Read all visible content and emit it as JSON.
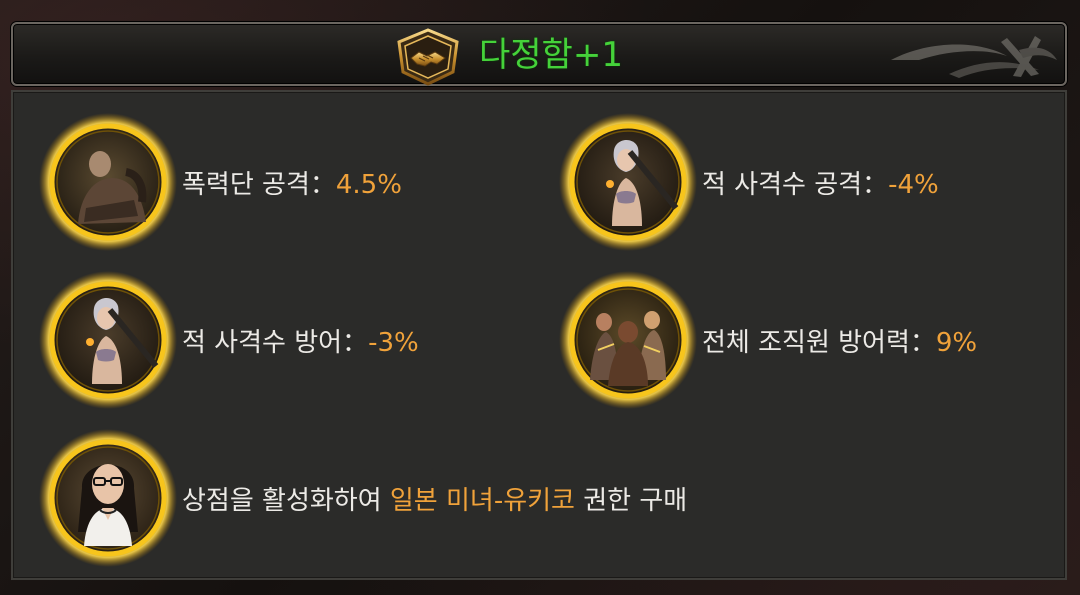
{
  "header": {
    "title": "다정함+1",
    "emblem_icon": "handshake-icon"
  },
  "colors": {
    "title_green": "#45d23a",
    "value_orange": "#f0a23a",
    "text_white": "#eceae6",
    "frame_gold": "#f4c21a"
  },
  "buffs": [
    {
      "label": "폭력단 공격：",
      "value": "4.5%",
      "portrait": "gang-brute-portrait"
    },
    {
      "label": "적 사격수 공격：",
      "value": "-4%",
      "portrait": "sniper-woman-portrait"
    },
    {
      "label": "적 사격수 방어：",
      "value": "-3%",
      "portrait": "sniper-woman-portrait"
    },
    {
      "label": "전체 조직원 방어력：",
      "value": "9%",
      "portrait": "gang-group-portrait"
    }
  ],
  "shop": {
    "prefix": "상점을 활성화하여 ",
    "highlight": "일본 미녀-유키코",
    "suffix": " 권한 구매",
    "portrait": "yukiko-portrait"
  }
}
